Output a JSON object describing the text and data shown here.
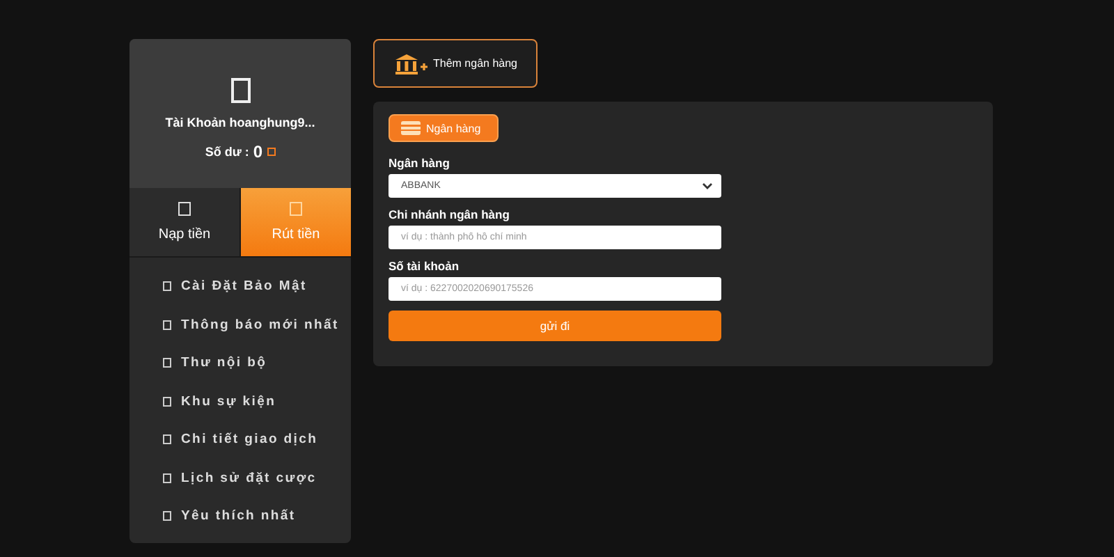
{
  "account": {
    "name": "Tài Khoản hoanghung9...",
    "balance_label": "Số dư :",
    "balance": "0"
  },
  "tabs": [
    {
      "label": "Nạp tiền",
      "selected": false
    },
    {
      "label": "Rút tiền",
      "selected": true
    }
  ],
  "menu": [
    "Cài Đặt Bảo Mật",
    "Thông báo mới nhất",
    "Thư nội bộ",
    "Khu sự kiện",
    "Chi tiết giao dịch",
    "Lịch sử đặt cược",
    "Yêu thích nhất"
  ],
  "add_bank_button": "Thêm ngân hàng",
  "form": {
    "tab": "Ngân hàng",
    "fields": [
      {
        "label": "Ngân hàng",
        "kind": "select",
        "value": "ABBANK"
      },
      {
        "label": "Chi nhánh ngân hàng",
        "kind": "text",
        "placeholder": "ví dụ : thành phố hồ chí minh"
      },
      {
        "label": "Số tài khoản",
        "kind": "text",
        "placeholder": "ví dụ : 6227002020690175526"
      }
    ],
    "submit": "gửi đi"
  }
}
